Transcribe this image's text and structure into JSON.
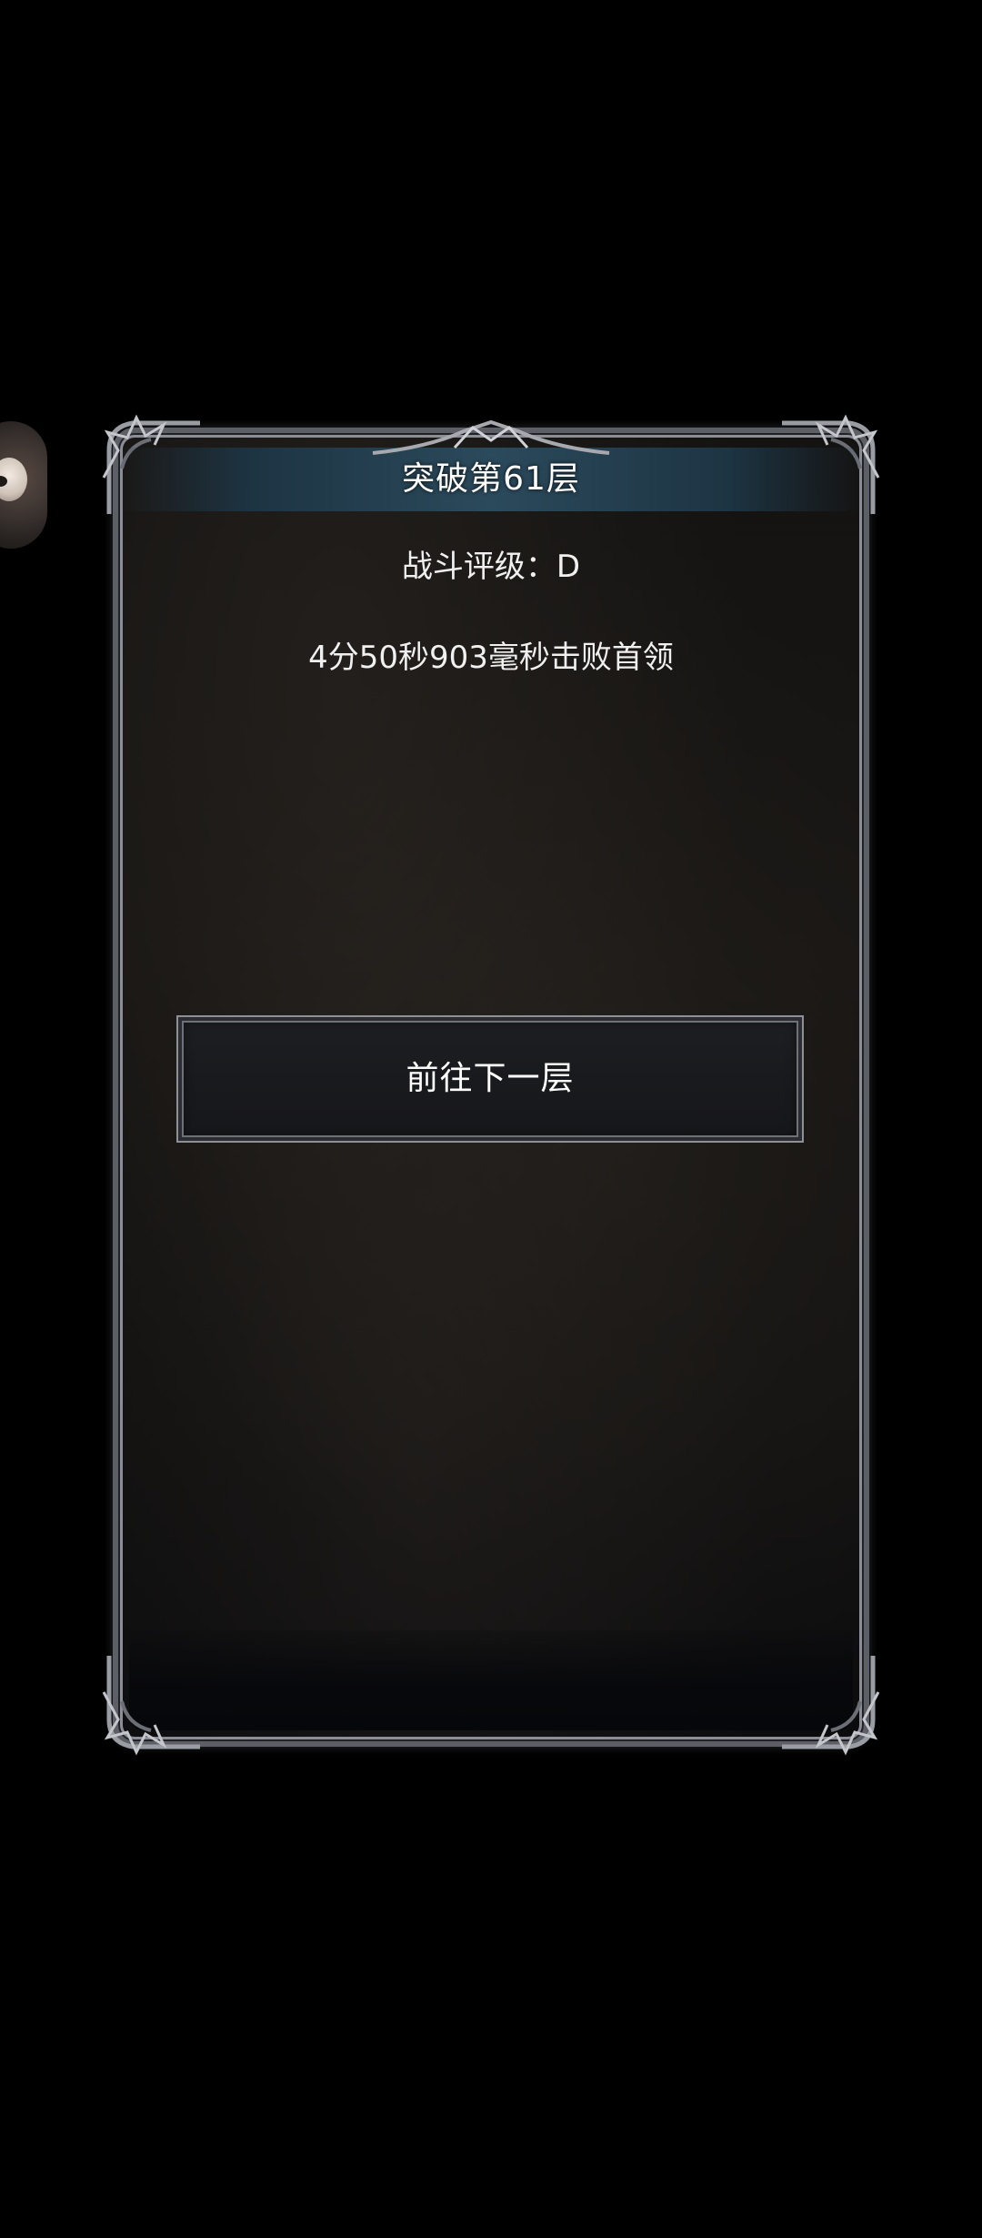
{
  "dialog": {
    "title": "突破第61层",
    "rating_text": "战斗评级：D",
    "time_text": "4分50秒903毫秒击败首领",
    "next_button_label": "前往下一层"
  },
  "colors": {
    "background": "#000000",
    "panel_border": "#8b8e96",
    "title_banner": "#2b4a5c",
    "text": "#ffffff"
  }
}
